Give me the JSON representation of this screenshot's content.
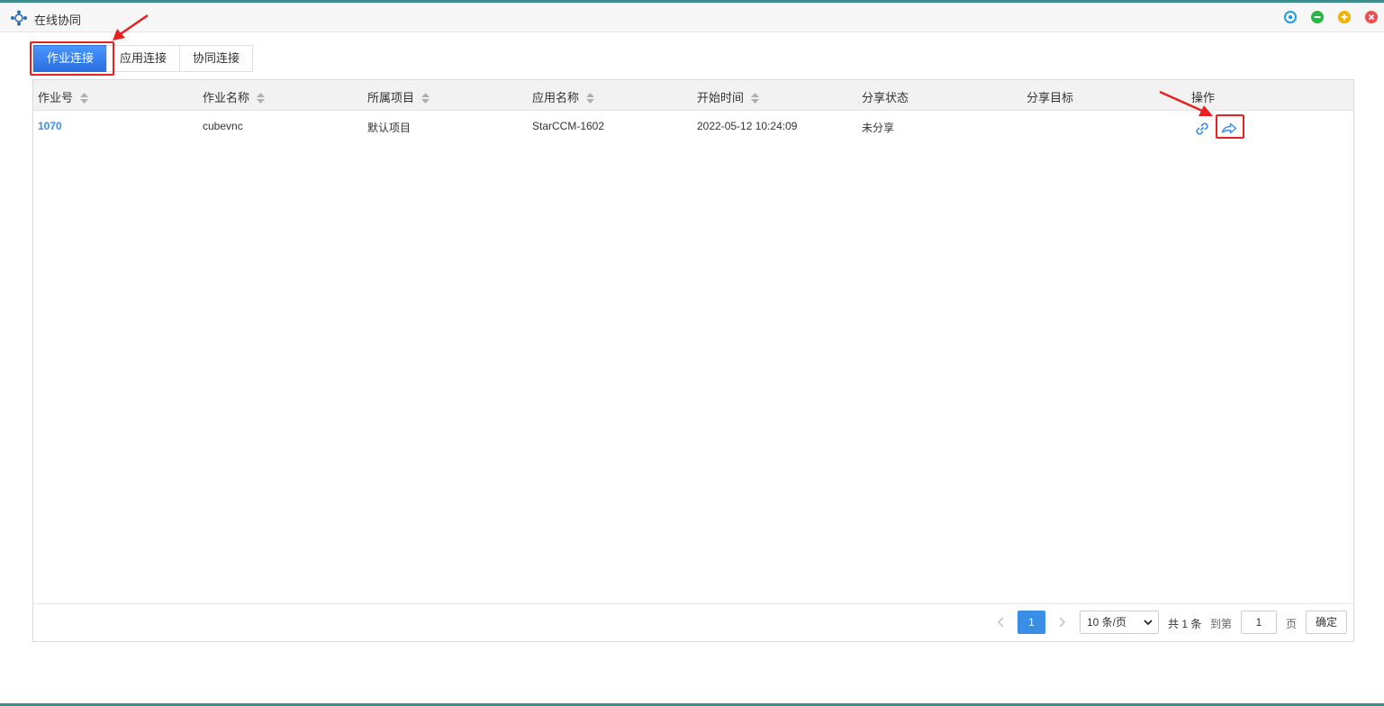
{
  "window": {
    "title": "在线协同",
    "buttons": {
      "target": "#1e9fe0",
      "minimize": "#2cb64a",
      "maximize": "#f5b100",
      "close": "#ef4d4d"
    }
  },
  "tabs": [
    {
      "label": "作业连接",
      "active": true
    },
    {
      "label": "应用连接",
      "active": false
    },
    {
      "label": "协同连接",
      "active": false
    }
  ],
  "table": {
    "columns": [
      {
        "label": "作业号",
        "sortable": true
      },
      {
        "label": "作业名称",
        "sortable": true
      },
      {
        "label": "所属项目",
        "sortable": true
      },
      {
        "label": "应用名称",
        "sortable": true
      },
      {
        "label": "开始时间",
        "sortable": true
      },
      {
        "label": "分享状态",
        "sortable": false
      },
      {
        "label": "分享目标",
        "sortable": false
      },
      {
        "label": "操作",
        "sortable": false
      }
    ],
    "rows": [
      {
        "job_id": "1070",
        "job_name": "cubevnc",
        "project": "默认项目",
        "app_name": "StarCCM-1602",
        "start_time": "2022-05-12 10:24:09",
        "share_status": "未分享",
        "share_target": "",
        "actions": [
          "link-icon",
          "share-icon"
        ]
      }
    ]
  },
  "pagination": {
    "current_page": "1",
    "page_size": "10 条/页",
    "total": "共 1 条",
    "goto_label": "到第",
    "goto_value": "1",
    "page_unit": "页",
    "confirm": "确定"
  },
  "colors": {
    "accent": "#3a8ee6",
    "highlight": "#e82020"
  }
}
